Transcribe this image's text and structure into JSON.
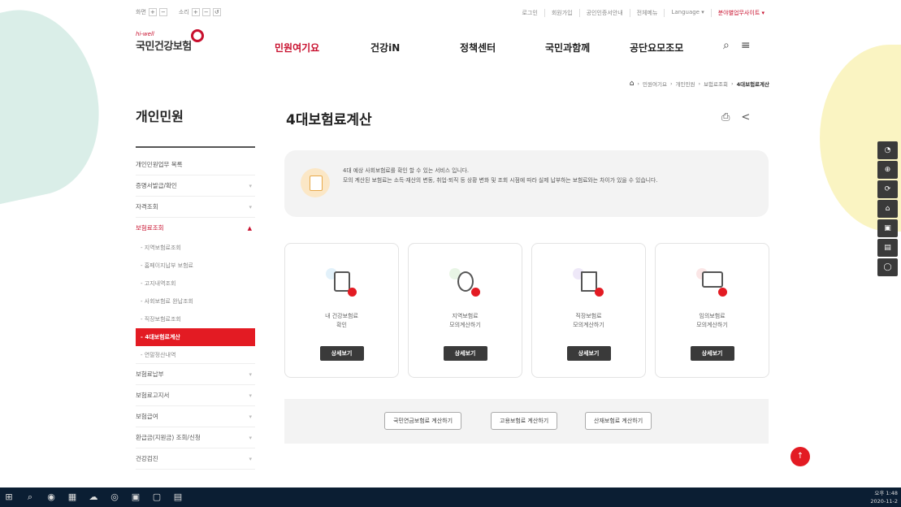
{
  "util": {
    "zoom_label": "화면",
    "sound_label": "소리",
    "plus": "+",
    "minus": "−",
    "reset": "↺"
  },
  "toplinks": [
    "로그인",
    "회원가입",
    "공인인증서안내",
    "전체메뉴",
    "Language ▾",
    "분야별업무사이트 ▾"
  ],
  "logo": {
    "small": "hi-well",
    "name": "국민건강보험"
  },
  "gnb": [
    "민원여기요",
    "건강iN",
    "정책센터",
    "국민과함께",
    "공단요모조모"
  ],
  "gnb_icons": {
    "search": "⌕",
    "menu": "≡"
  },
  "breadcrumb": [
    "민원여기요",
    "개인민원",
    "보험료조회",
    "4대보험료계산"
  ],
  "lnb": {
    "title": "개인민원",
    "items_top": [
      "개인민원업무 목록",
      "증명서발급/확인",
      "자격조회"
    ],
    "open_item": "보험료조회",
    "subs": [
      "지역보험료조회",
      "홈페이지납부 보험료",
      "고지내역조회",
      "사회보험료 완납조회",
      "직장보험료조회",
      "4대보험료계산",
      "연말정산내역"
    ],
    "items_bottom": [
      "보험료납부",
      "보험료고지서",
      "보험급여",
      "환급금(지원금) 조회/신청",
      "건강검진"
    ]
  },
  "page": {
    "title": "4대보험료계산"
  },
  "page_icons": {
    "print": "⎙",
    "share": "<"
  },
  "notice": {
    "line1": "4대 예상 사회보험료를 확인 할 수 있는 서비스 입니다.",
    "line2": "모의 계산된 보험료는 소득·재산의 변동, 취업·퇴직 등 상황 변화 및 조회 시점에 따라 실제 납부하는 보험료와는 차이가 있을 수 있습니다."
  },
  "cards": [
    {
      "line1": "내 건강보험료",
      "line2": "확인",
      "btn": "상세보기",
      "halo": "#cfe8f7"
    },
    {
      "line1": "지역보험료",
      "line2": "모의계산하기",
      "btn": "상세보기",
      "halo": "#d9efd3"
    },
    {
      "line1": "직장보험료",
      "line2": "모의계산하기",
      "btn": "상세보기",
      "halo": "#e2d8f4"
    },
    {
      "line1": "임의보험료",
      "line2": "모의계산하기",
      "btn": "상세보기",
      "halo": "#f9d6d6"
    }
  ],
  "calc_buttons": [
    "국민연금보험료 계산하기",
    "고용보험료 계산하기",
    "산재보험료 계산하기"
  ],
  "quick": [
    "◔",
    "⊕",
    "⟳",
    "⌂",
    "▣",
    "▤",
    "◯"
  ],
  "totop": "↑",
  "taskbar": {
    "icons": [
      "⊞",
      "⌕",
      "◉",
      "▦",
      "☁",
      "◎",
      "▣",
      "▢",
      "▤"
    ],
    "time": "오후 1:48",
    "date": "2020-11-2"
  }
}
